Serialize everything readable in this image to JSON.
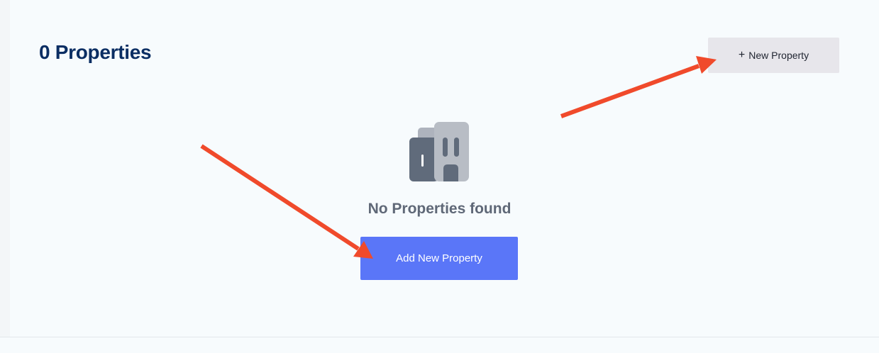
{
  "header": {
    "title": "0 Properties",
    "new_property_label": "New Property",
    "new_property_icon": "plus-icon"
  },
  "empty_state": {
    "icon": "buildings-icon",
    "message": "No Properties found",
    "add_button_label": "Add New Property"
  },
  "colors": {
    "title": "#0b2e63",
    "primary_button": "#5a76f8",
    "secondary_button": "#e7e6eb",
    "annotation_arrow": "#f04a2b",
    "muted_text": "#5f6877"
  },
  "annotations": [
    {
      "type": "arrow",
      "points_to": "new-property-button"
    },
    {
      "type": "arrow",
      "points_to": "add-new-property-button"
    }
  ]
}
